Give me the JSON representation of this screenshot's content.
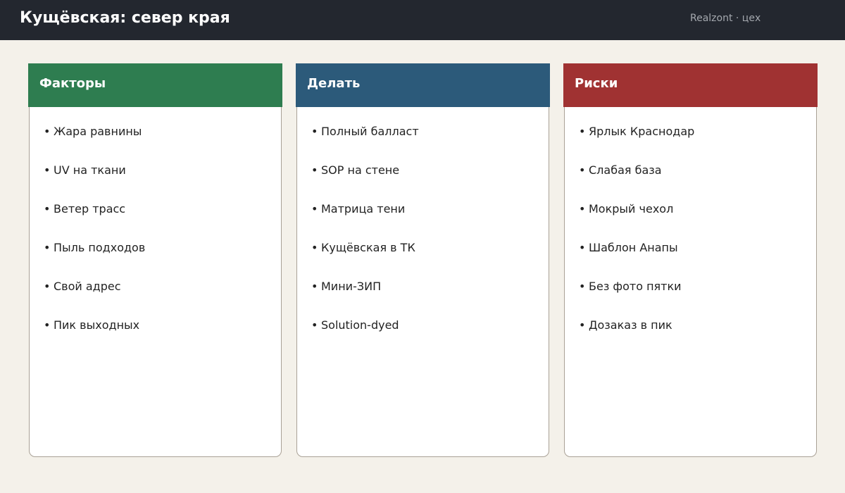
{
  "header": {
    "title": "Кущёвская: север края",
    "brand": "Realzont · цех"
  },
  "columns": [
    {
      "title": "Факторы",
      "color": "#2e7d50",
      "items": [
        "Жара равнины",
        "UV на ткани",
        "Ветер трасс",
        "Пыль подходов",
        "Свой адрес",
        "Пик выходных"
      ]
    },
    {
      "title": "Делать",
      "color": "#2c5a7a",
      "items": [
        "Полный балласт",
        "SOP на стене",
        "Матрица тени",
        "Кущёвская в ТК",
        "Мини-ЗИП",
        "Solution-dyed"
      ]
    },
    {
      "title": "Риски",
      "color": "#a03232",
      "items": [
        "Ярлык Краснодар",
        "Слабая база",
        "Мокрый чехол",
        "Шаблон Анапы",
        "Без фото пятки",
        "Дозаказ в пик"
      ]
    }
  ]
}
